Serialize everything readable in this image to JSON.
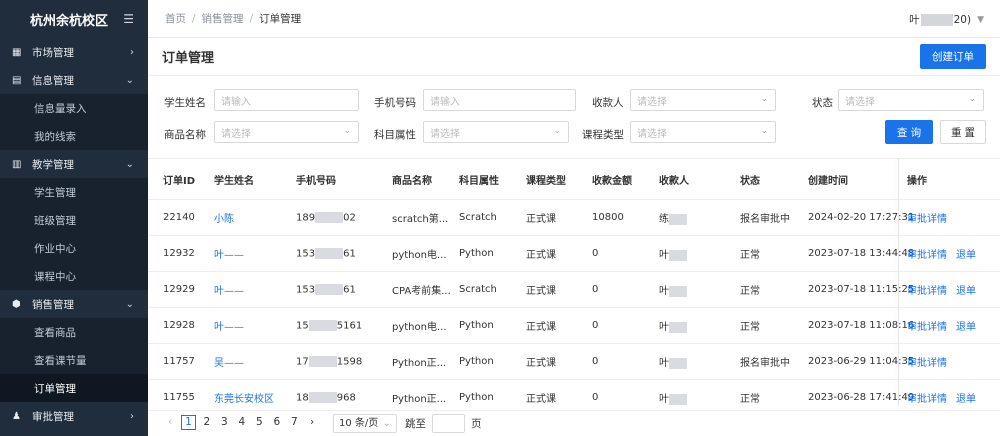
{
  "sidebar": {
    "title": "杭州余杭校区",
    "groups": [
      {
        "label": "市场管理"
      },
      {
        "label": "信息管理",
        "items": [
          "信息量录入",
          "我的线索"
        ]
      },
      {
        "label": "教学管理",
        "items": [
          "学生管理",
          "班级管理",
          "作业中心",
          "课程中心"
        ]
      },
      {
        "label": "销售管理",
        "items": [
          "查看商品",
          "查看课节量",
          "订单管理"
        ]
      },
      {
        "label": "审批管理"
      }
    ]
  },
  "breadcrumb": [
    "首页",
    "销售管理",
    "订单管理"
  ],
  "user": {
    "prefix": "叶",
    "suffix": "20)"
  },
  "page": {
    "title": "订单管理",
    "create_label": "创建订单"
  },
  "filters": {
    "student_name": {
      "label": "学生姓名",
      "placeholder": "请输入"
    },
    "phone": {
      "label": "手机号码",
      "placeholder": "请输入"
    },
    "payee": {
      "label": "收款人",
      "placeholder": "请选择"
    },
    "status": {
      "label": "状态",
      "placeholder": "请选择"
    },
    "product": {
      "label": "商品名称",
      "placeholder": "请选择"
    },
    "subject": {
      "label": "科目属性",
      "placeholder": "请选择"
    },
    "course_type": {
      "label": "课程类型",
      "placeholder": "请选择"
    },
    "query_label": "查 询",
    "reset_label": "重 置"
  },
  "table": {
    "headers": [
      "订单ID",
      "学生姓名",
      "手机号码",
      "商品名称",
      "科目属性",
      "课程类型",
      "收款金额",
      "收款人",
      "状态",
      "创建时间",
      "操作"
    ],
    "rows": [
      {
        "id": "22140",
        "name": "小陈",
        "phone_a": "189",
        "phone_b": "02",
        "product": "scratch第...",
        "subject": "Scratch",
        "type": "正式课",
        "amount": "10800",
        "payee": "练",
        "status": "报名审批中",
        "time": "2024-02-20 17:27:31",
        "ops": [
          "审批详情"
        ]
      },
      {
        "id": "12932",
        "name": "叶——",
        "phone_a": "153",
        "phone_b": "61",
        "product": "python电...",
        "subject": "Python",
        "type": "正式课",
        "amount": "0",
        "payee": "叶",
        "status": "正常",
        "time": "2023-07-18 13:44:48",
        "ops": [
          "审批详情",
          "退单"
        ]
      },
      {
        "id": "12929",
        "name": "叶——",
        "phone_a": "153",
        "phone_b": "61",
        "product": "CPA考前集...",
        "subject": "Scratch",
        "type": "正式课",
        "amount": "0",
        "payee": "叶",
        "status": "正常",
        "time": "2023-07-18 11:15:25",
        "ops": [
          "审批详情",
          "退单"
        ]
      },
      {
        "id": "12928",
        "name": "叶——",
        "phone_a": "15",
        "phone_b": "5161",
        "product": "python电...",
        "subject": "Python",
        "type": "正式课",
        "amount": "0",
        "payee": "叶",
        "status": "正常",
        "time": "2023-07-18 11:08:16",
        "ops": [
          "审批详情",
          "退单"
        ]
      },
      {
        "id": "11757",
        "name": "吴——",
        "phone_a": "17",
        "phone_b": "1598",
        "product": "Python正...",
        "subject": "Python",
        "type": "正式课",
        "amount": "0",
        "payee": "叶",
        "status": "报名审批中",
        "time": "2023-06-29 11:04:35",
        "ops": [
          "审批详情"
        ]
      },
      {
        "id": "11755",
        "name": "东莞长安校区",
        "phone_a": "18",
        "phone_b": "968",
        "product": "Python正...",
        "subject": "Python",
        "type": "正式课",
        "amount": "0",
        "payee": "叶",
        "status": "正常",
        "time": "2023-06-28 17:41:49",
        "ops": [
          "审批详情",
          "退单"
        ]
      }
    ]
  },
  "pagination": {
    "pages": [
      "1",
      "2",
      "3",
      "4",
      "5",
      "6",
      "7"
    ],
    "current": "1",
    "size": "10 条/页",
    "goto_label": "跳至",
    "page_label": "页"
  },
  "colors": {
    "primary": "#1a73e8",
    "sidebar_bg": "#1f2d3d"
  }
}
